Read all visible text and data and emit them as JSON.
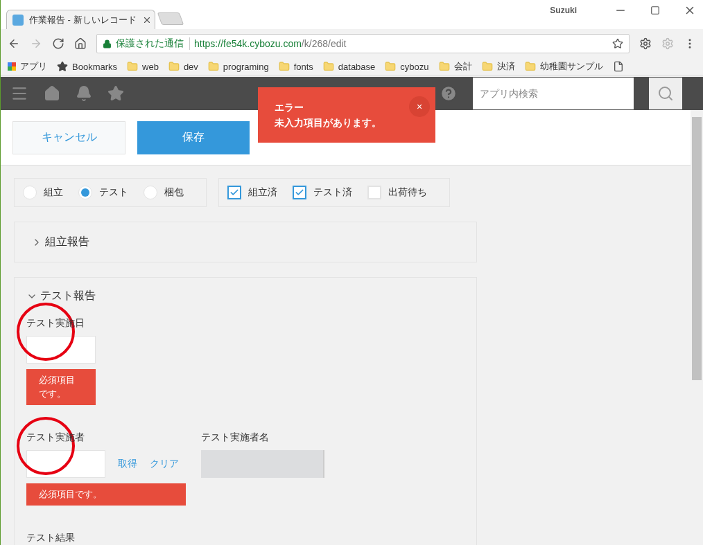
{
  "browser": {
    "user": "Suzuki",
    "tab": {
      "title": "作業報告 - 新しいレコード"
    },
    "address": {
      "secure_label": "保護された通信",
      "url_host": "https://fe54k.cybozu.com",
      "url_path": "/k/268/edit"
    },
    "bookmarks": [
      {
        "kind": "apps",
        "label": "アプリ"
      },
      {
        "kind": "star",
        "label": "Bookmarks"
      },
      {
        "kind": "folder",
        "label": "web"
      },
      {
        "kind": "folder",
        "label": "dev"
      },
      {
        "kind": "folder",
        "label": "programing"
      },
      {
        "kind": "folder",
        "label": "fonts"
      },
      {
        "kind": "folder",
        "label": "database"
      },
      {
        "kind": "folder",
        "label": "cybozu"
      },
      {
        "kind": "folder",
        "label": "会計"
      },
      {
        "kind": "folder",
        "label": "決済"
      },
      {
        "kind": "folder",
        "label": "幼稚園サンプル"
      },
      {
        "kind": "page"
      }
    ]
  },
  "header": {
    "search": {
      "placeholder": "アプリ内検索"
    }
  },
  "toast": {
    "title": "エラー",
    "message": "未入力項目があります。",
    "close": "×"
  },
  "actions": {
    "cancel": "キャンセル",
    "save": "保存"
  },
  "radio_group": {
    "options": [
      {
        "label": "組立",
        "selected": false
      },
      {
        "label": "テスト",
        "selected": true
      },
      {
        "label": "梱包",
        "selected": false
      }
    ]
  },
  "checkbox_group": {
    "options": [
      {
        "label": "組立済",
        "checked": true
      },
      {
        "label": "テスト済",
        "checked": true
      },
      {
        "label": "出荷待ち",
        "checked": false
      }
    ]
  },
  "sections": [
    {
      "title": "組立報告",
      "expanded": false
    },
    {
      "title": "テスト報告",
      "expanded": true,
      "fields": [
        {
          "kind": "date",
          "label": "テスト実施日",
          "circled": true,
          "error": "必須項目です。"
        },
        {
          "kind": "user",
          "label": "テスト実施者",
          "circled": true,
          "links": [
            "取得",
            "クリア"
          ],
          "error": "必須項目です。",
          "lookup": {
            "label": "テスト実施者名"
          }
        },
        {
          "kind": "textarea",
          "label": "テスト結果",
          "circled": false
        }
      ]
    }
  ]
}
